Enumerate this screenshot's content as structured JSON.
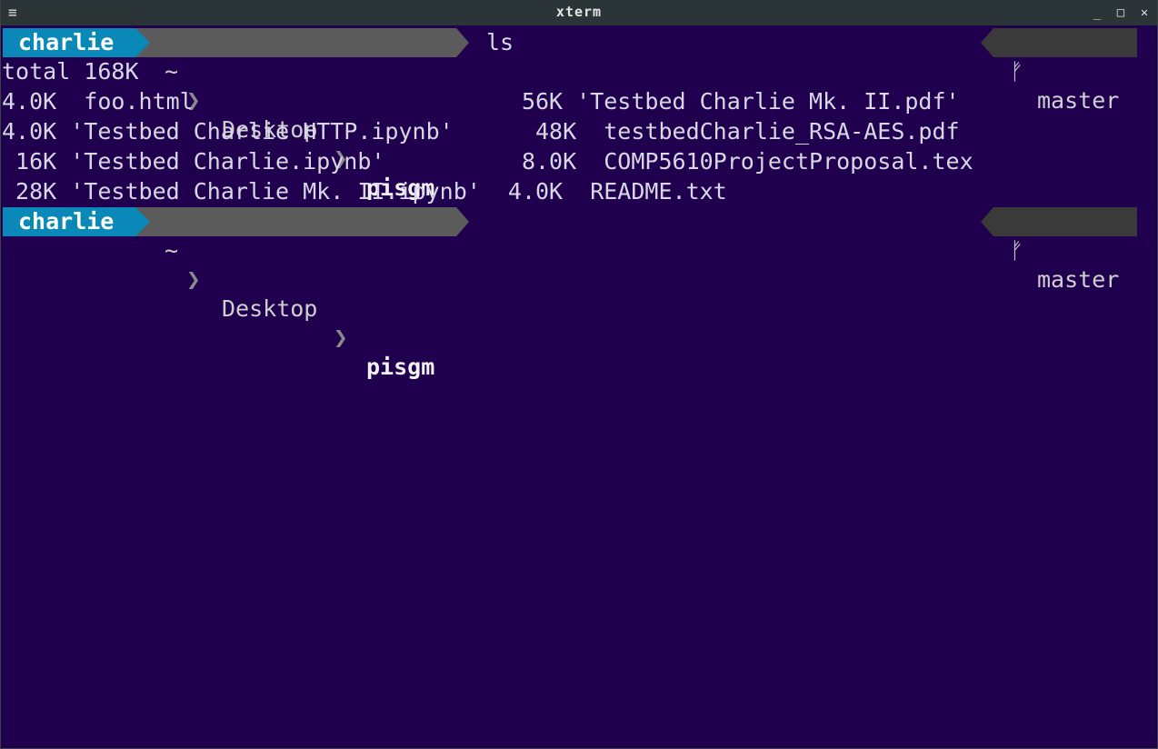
{
  "window": {
    "title": "xterm",
    "menu_glyph": "≡",
    "minimize_glyph": "_",
    "maximize_glyph": "□",
    "close_glyph": "✕"
  },
  "prompt": {
    "user": "charlie",
    "home": "~",
    "separator": "❯",
    "dir1": "Desktop",
    "dir2": "pisgm",
    "git_icon": "ᚠ",
    "branch": "master"
  },
  "command": "ls",
  "output": [
    "total 168K",
    "4.0K  foo.html                        56K 'Testbed Charlie Mk. II.pdf'",
    "4.0K 'Testbed Charlie HTTP.ipynb'      48K  testbedCharlie_RSA-AES.pdf",
    " 16K 'Testbed Charlie.ipynb'          8.0K  COMP5610ProjectProposal.tex",
    " 28K 'Testbed Charlie Mk. II.ipynb'  4.0K  README.txt"
  ],
  "colors": {
    "background": "#20004e",
    "user_segment": "#0a89b8",
    "path_segment": "#5b5b5b",
    "git_segment": "#3a3a3a",
    "titlebar": "#2b3437"
  }
}
